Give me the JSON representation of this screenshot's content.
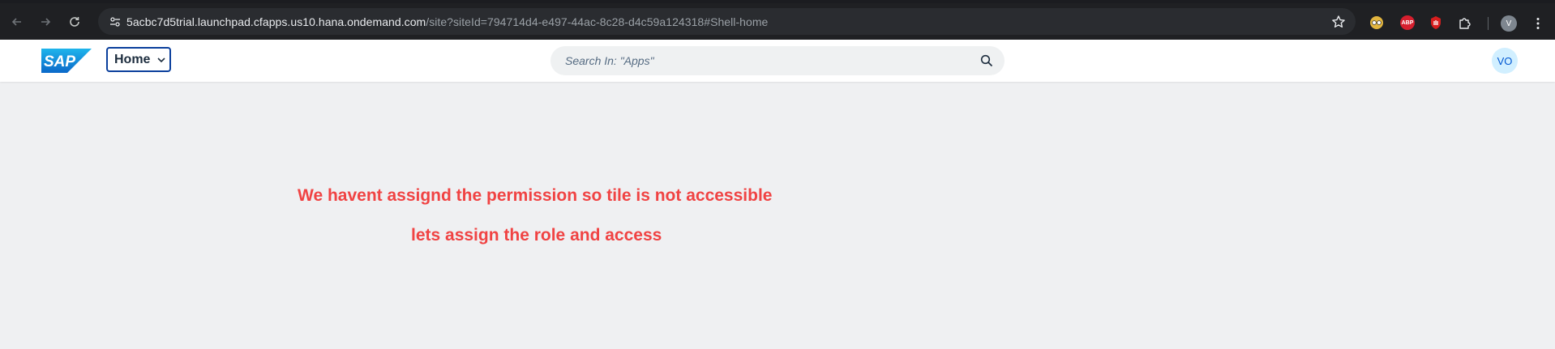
{
  "browser": {
    "url_host": "5acbc7d5trial.launchpad.cfapps.us10.hana.ondemand.com",
    "url_path": "/site?siteId=794714d4-e497-44ac-8c28-d4c59a124318#Shell-home",
    "abp_label": "ABP",
    "profile_initial": "V"
  },
  "shell": {
    "logo_text": "SAP",
    "home_label": "Home",
    "search_placeholder": "Search In: \"Apps\"",
    "avatar_initials": "VO"
  },
  "annotation": {
    "line1": "We havent assignd the permission so tile is not accessible",
    "line2": "lets assign the role and access",
    "color": "#f04343"
  }
}
